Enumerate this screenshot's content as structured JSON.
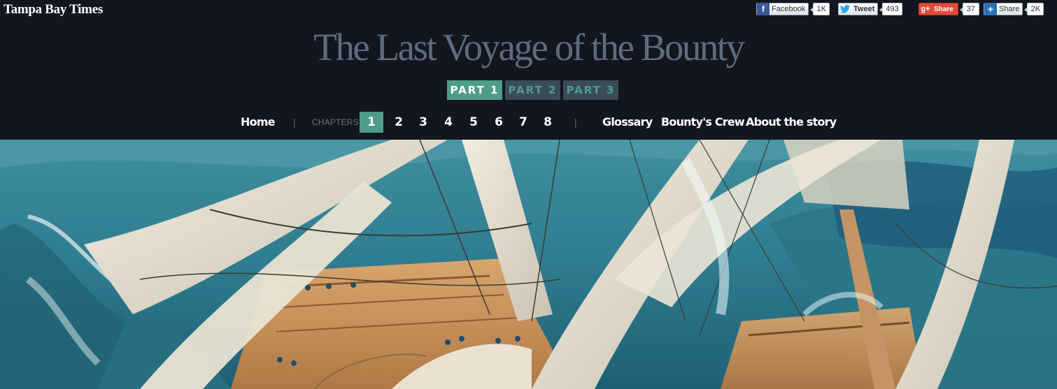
{
  "masthead": {
    "logo": "Tampa Bay Times"
  },
  "social": {
    "facebook": {
      "label": "Facebook",
      "count": "1K"
    },
    "twitter": {
      "label": "Tweet",
      "count": "493"
    },
    "googleplus": {
      "label": "Share",
      "count": "37"
    },
    "share": {
      "label": "Share",
      "count": "2K"
    }
  },
  "title": "The Last Voyage of the Bounty",
  "parts": [
    {
      "label": "PART 1",
      "active": true
    },
    {
      "label": "PART 2",
      "active": false
    },
    {
      "label": "PART 3",
      "active": false
    }
  ],
  "nav": {
    "home": "Home",
    "separator": "|",
    "chapters_label": "CHAPTERS:",
    "chapters": [
      "1",
      "2",
      "3",
      "4",
      "5",
      "6",
      "7",
      "8"
    ],
    "active_chapter": "1",
    "glossary": "Glossary",
    "crew": "Bounty's Crew",
    "about": "About the story"
  },
  "colors": {
    "header_bg": "#13161f",
    "accent": "#4e9d8a",
    "title": "#5d6b7d",
    "inactive_part": "#3a4c58"
  },
  "hero": {
    "subject": "watercolor of a tall ship with broken masts in stormy seas"
  }
}
